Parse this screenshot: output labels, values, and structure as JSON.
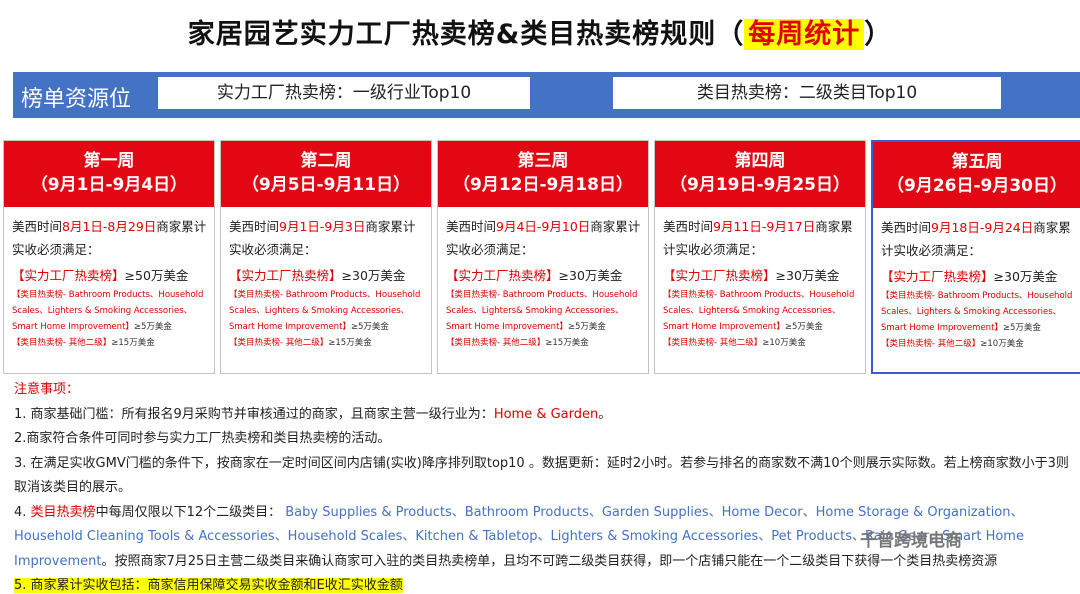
{
  "title": {
    "main": "家居园艺实力工厂热卖榜&类目热卖榜规则（",
    "highlight": "每周统计",
    "close": "）"
  },
  "resource": {
    "label": "榜单资源位",
    "box1": "实力工厂热卖榜：一级行业Top10",
    "box2": "类目热卖榜：二级类目Top10"
  },
  "weeks": [
    {
      "name": "第一周",
      "range": "（9月1日-9月4日）",
      "pre": "美西时间",
      "dates": "8月1日-8月29日",
      "post": "商家累计实收必须满足：",
      "rank1": "【实力工厂热卖榜】",
      "amt1": "≥50万美金",
      "cat": "【类目热卖榜- Bathroom Products、Household Scales、Lighters & Smoking Accessories、Smart Home Improvement】",
      "amt2": "≥5万美金",
      "other": "【类目热卖榜- 其他二级】",
      "amt3": "≥15万美金"
    },
    {
      "name": "第二周",
      "range": "（9月5日-9月11日）",
      "pre": "美西时间",
      "dates": "9月1日-9月3日",
      "post": "商家累计实收必须满足：",
      "rank1": "【实力工厂热卖榜】",
      "amt1": "≥30万美金",
      "cat": "【类目热卖榜- Bathroom Products、Household Scales、Lighters & Smoking Accessories、Smart Home Improvement】",
      "amt2": "≥5万美金",
      "other": "【类目热卖榜- 其他二级】",
      "amt3": "≥15万美金"
    },
    {
      "name": "第三周",
      "range": "（9月12日-9月18日）",
      "pre": "美西时间",
      "dates": "9月4日-9月10日",
      "post": "商家累计实收必须满足：",
      "rank1": "【实力工厂热卖榜】",
      "amt1": "≥30万美金",
      "cat": "【类目热卖榜- Bathroom Products、Household Scales、Lighters& Smoking Accessories、Smart Home Improvement】",
      "amt2": "≥5万美金",
      "other": "【类目热卖榜- 其他二级】",
      "amt3": "≥15万美金"
    },
    {
      "name": "第四周",
      "range": "（9月19日-9月25日）",
      "pre": "美西时间",
      "dates": "9月11日-9月17日",
      "post": "商家累计实收必须满足：",
      "rank1": "【实力工厂热卖榜】",
      "amt1": "≥30万美金",
      "cat": "【类目热卖榜- Bathroom Products、Household Scales、Lighters& Smoking Accessories、Smart Home Improvement】",
      "amt2": "≥5万美金",
      "other": "【类目热卖榜- 其他二级】",
      "amt3": "≥10万美金"
    },
    {
      "name": "第五周",
      "range": "（9月26日-9月30日）",
      "pre": "美西时间",
      "dates": "9月18日-9月24日",
      "post": "商家累计实收必须满足：",
      "rank1": "【实力工厂热卖榜】",
      "amt1": "≥30万美金",
      "cat": "【类目热卖榜- Bathroom Products、Household Scales、Lighters & Smoking Accessories、Smart Home Improvement】",
      "amt2": "≥5万美金",
      "other": "【类目热卖榜- 其他二级】",
      "amt3": "≥10万美金"
    }
  ],
  "notes": {
    "header": "注意事项：",
    "n1_pre": "1. 商家基础门槛：所有报名9月采购节并审核通过的商家，且商家主营一级行业为：",
    "n1_hl": "Home & Garden",
    "n1_post": "。",
    "n2": "2.商家符合条件可同时参与实力工厂热卖榜和类目热卖榜的活动。",
    "n3": "3. 在满足实收GMV门槛的条件下，按商家在一定时间区间内店铺(实收)降序排列取top10 。数据更新：延时2小时。若参与排名的商家数不满10个则展示实际数。若上榜商家数小于3则取消该类目的展示。",
    "n4_pre": "4. ",
    "n4_red": "类目热卖榜",
    "n4_mid": "中每周仅限以下12个二级类目：",
    "n4_cats": "Baby Supplies & Products、Bathroom Products、Garden Supplies、Home Decor、Home Storage & Organization、Household Cleaning Tools & Accessories、Household Scales、Kitchen & Tabletop、Lighters & Smoking Accessories、Pet Products、Rain Gear、Smart Home Improvement",
    "n4_post": "。按照商家7月25日主营二级类目来确认商家可入驻的类目热卖榜单，且均不可跨二级类目获得，即一个店铺只能在一个二级类目下获得一个类目热卖榜资源",
    "n5": "5. 商家累计实收包括：商家信用保障交易实收金额和E收汇实收金额"
  },
  "watermark": "千普跨境电商"
}
